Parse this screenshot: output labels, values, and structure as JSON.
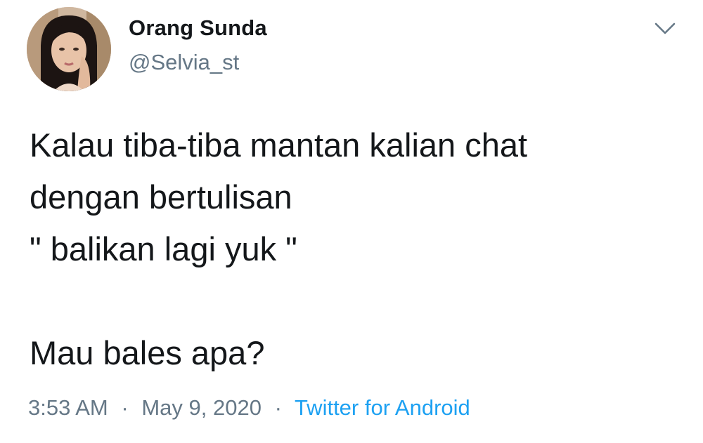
{
  "author": {
    "display_name": "Orang Sunda",
    "handle": "@Selvia_st"
  },
  "tweet": {
    "lines": [
      "Kalau tiba-tiba mantan kalian chat",
      "dengan bertulisan",
      "\" balikan lagi yuk \"",
      "",
      "Mau bales apa?"
    ]
  },
  "meta": {
    "time": "3:53 AM",
    "separator": "·",
    "date": "May 9, 2020",
    "source": "Twitter for Android"
  },
  "icons": {
    "menu": "chevron-down-icon"
  },
  "colors": {
    "text": "#14171a",
    "secondary": "#657786",
    "link": "#1da1f2"
  }
}
